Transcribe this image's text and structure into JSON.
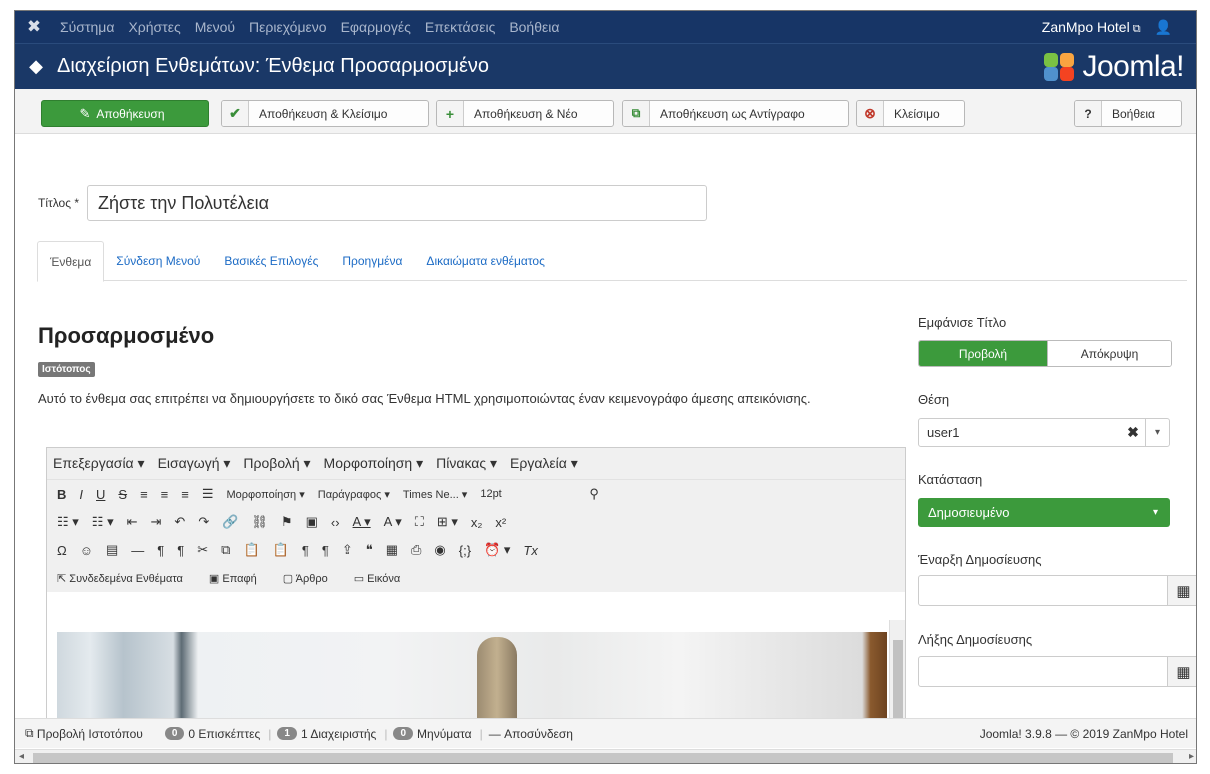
{
  "topnav": {
    "menu": [
      "Σύστημα",
      "Χρήστες",
      "Μενού",
      "Περιεχόμενο",
      "Εφαρμογές",
      "Επεκτάσεις",
      "Βοήθεια"
    ],
    "site_name": "ZanMpo Hotel"
  },
  "header": {
    "title": "Διαχείριση Ενθεμάτων: Ένθεμα Προσαρμοσμένο",
    "logo_text": "Joomla!"
  },
  "toolbar": {
    "save": "Αποθήκευση",
    "save_close": "Αποθήκευση & Κλείσιμο",
    "save_new": "Αποθήκευση & Νέο",
    "save_copy": "Αποθήκευση ως Αντίγραφο",
    "close": "Κλείσιμο",
    "help": "Βοήθεια"
  },
  "form": {
    "title_label": "Τίτλος *",
    "title_value": "Ζήστε την Πολυτέλεια"
  },
  "tabs": [
    "Ένθεμα",
    "Σύνδεση Μενού",
    "Βασικές Επιλογές",
    "Προηγμένα",
    "Δικαιώματα ενθέματος"
  ],
  "module": {
    "heading": "Προσαρμοσμένο",
    "badge": "Ιστότοπος",
    "description": "Αυτό το ένθεμα σας επιτρέπει να δημιουργήσετε το δικό σας Ένθεμα HTML χρησιμοποιώντας έναν κειμενογράφο άμεσης απεικόνισης."
  },
  "editor": {
    "menubar": [
      "Επεξεργασία ▾",
      "Εισαγωγή ▾",
      "Προβολή ▾",
      "Μορφοποίηση ▾",
      "Πίνακας ▾",
      "Εργαλεία ▾"
    ],
    "format_select": "Μορφοποίηση ▾",
    "paragraph_select": "Παράγραφος ▾",
    "font_select": "Times Ne... ▾",
    "size_select": "12pt",
    "buttons": [
      "Συνδεδεμένα Ενθέματα",
      "Επαφή",
      "Άρθρο",
      "Εικόνα"
    ]
  },
  "sidebar": {
    "show_title_label": "Εμφάνισε Τίτλο",
    "show_option": "Προβολή",
    "hide_option": "Απόκρυψη",
    "position_label": "Θέση",
    "position_value": "user1",
    "status_label": "Κατάσταση",
    "status_value": "Δημοσιευμένο",
    "publish_up_label": "Έναρξη Δημοσίευσης",
    "publish_down_label": "Λήξης Δημοσίευσης"
  },
  "statusbar": {
    "preview": "Προβολή Ιστοτόπου",
    "visitors_count": "0",
    "visitors_label": "0 Επισκέπτες",
    "admins_count": "1",
    "admins_label": "1 Διαχειριστής",
    "messages_count": "0",
    "messages_label": "Μηνύματα",
    "logout": "Αποσύνδεση",
    "version": "Joomla! 3.9.8 — © 2019 ZanMpo Hotel"
  },
  "colors": {
    "nav": "#173566",
    "header": "#1a3867",
    "success": "#3c9a3c",
    "link": "#1c6bc5"
  }
}
